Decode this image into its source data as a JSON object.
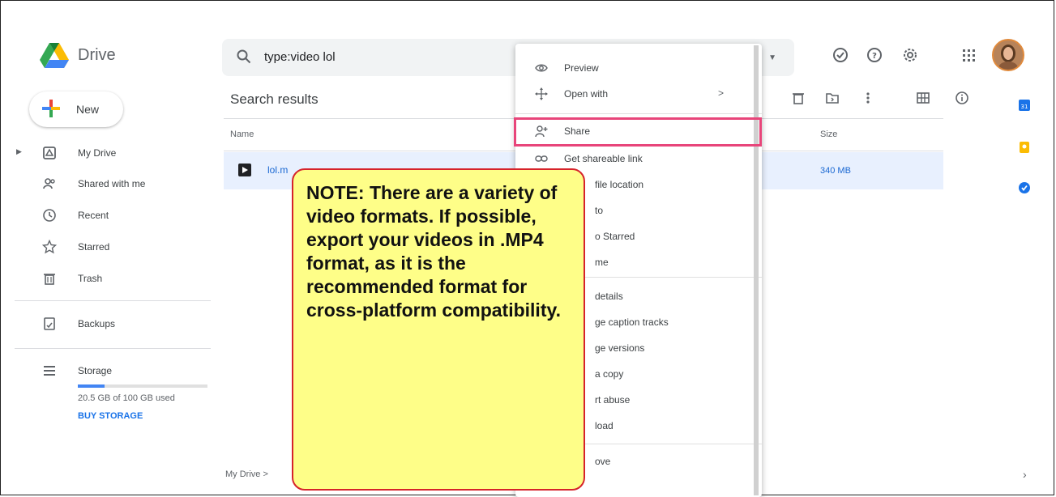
{
  "app": {
    "name": "Drive"
  },
  "search": {
    "query": "type:video lol"
  },
  "new_button": {
    "label": "New"
  },
  "sidebar": {
    "items": [
      {
        "label": "My Drive",
        "icon": "my-drive-icon"
      },
      {
        "label": "Shared with me",
        "icon": "people-icon"
      },
      {
        "label": "Recent",
        "icon": "clock-icon"
      },
      {
        "label": "Starred",
        "icon": "star-icon"
      },
      {
        "label": "Trash",
        "icon": "trash-icon"
      }
    ],
    "backups": "Backups",
    "storage": {
      "label": "Storage",
      "used": "20.5 GB of 100 GB used",
      "used_fraction": 0.205,
      "buy": "BUY STORAGE"
    }
  },
  "content": {
    "title": "Search results",
    "columns": {
      "name": "Name",
      "size": "Size"
    },
    "file": {
      "name": "lol.m",
      "size": "340 MB"
    },
    "breadcrumb": "My Drive >"
  },
  "context_menu": {
    "items": [
      {
        "label": "Preview",
        "icon": "eye-icon"
      },
      {
        "label": "Open with",
        "icon": "move-arrows-icon",
        "submenu": ">"
      },
      {
        "label": "Share",
        "icon": "person-add-icon"
      },
      {
        "label": "Get shareable link",
        "icon": "link-icon"
      },
      {
        "label": "file location"
      },
      {
        "label": "to"
      },
      {
        "label": "o Starred"
      },
      {
        "label": "me"
      },
      {
        "label": "details"
      },
      {
        "label": "ge caption tracks"
      },
      {
        "label": "ge versions"
      },
      {
        "label": "a copy"
      },
      {
        "label": "rt abuse"
      },
      {
        "label": "load"
      },
      {
        "label": "ove"
      }
    ]
  },
  "note": {
    "text": "NOTE: There are a variety of video formats. If possible, export your videos in .MP4 format, as it is the recommended format for cross-platform compatibility."
  },
  "colors": {
    "accent": "#1a73e8",
    "highlight": "#e8457a",
    "note_bg": "#fefe88",
    "note_border": "#d6232a"
  }
}
